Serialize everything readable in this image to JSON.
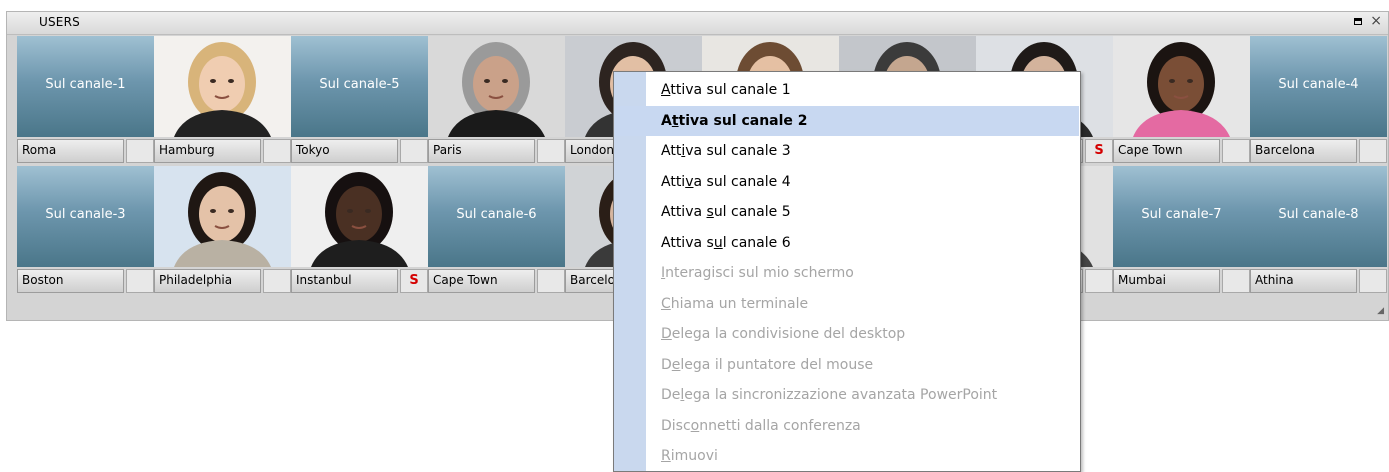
{
  "panel": {
    "title": "USERS",
    "maximize_icon": "maximize-icon",
    "close_icon": "close-icon"
  },
  "row1": [
    {
      "type": "canal",
      "canal_text": "Sul canale-1",
      "label": "Roma",
      "s": ""
    },
    {
      "type": "photo",
      "photo": "woman-blonde",
      "label": "Hamburg",
      "s": ""
    },
    {
      "type": "canal",
      "canal_text": "Sul canale-5",
      "label": "Tokyo",
      "s": ""
    },
    {
      "type": "photo",
      "photo": "man-gray-hair-glasses",
      "label": "Paris",
      "s": ""
    },
    {
      "type": "photo",
      "photo": "woman-dark-hair",
      "label": "London",
      "s": ""
    },
    {
      "type": "photo",
      "photo": "woman-hidden",
      "label": "",
      "s": ""
    },
    {
      "type": "photo",
      "photo": "hidden",
      "label": "",
      "s": ""
    },
    {
      "type": "photo",
      "photo": "woman-dark-hair-2",
      "label": "",
      "s": "S"
    },
    {
      "type": "photo",
      "photo": "woman-smiling",
      "label": "Cape Town",
      "s": ""
    },
    {
      "type": "canal",
      "canal_text": "Sul canale-4",
      "label": "Barcelona",
      "s": ""
    }
  ],
  "row2": [
    {
      "type": "canal",
      "canal_text": "Sul canale-3",
      "label": "Boston",
      "s": ""
    },
    {
      "type": "photo",
      "photo": "woman-asian",
      "label": "Philadelphia",
      "s": ""
    },
    {
      "type": "photo",
      "photo": "man-dark",
      "label": "Instanbul",
      "s": "S"
    },
    {
      "type": "canal",
      "canal_text": "Sul canale-6",
      "label": "Cape Town",
      "s": ""
    },
    {
      "type": "photo",
      "photo": "woman-dark",
      "label": "Barcelona",
      "s": ""
    },
    {
      "type": "photo",
      "photo": "hidden",
      "label": "",
      "s": ""
    },
    {
      "type": "photo",
      "photo": "hidden",
      "label": "",
      "s": ""
    },
    {
      "type": "photo",
      "photo": "woman-hidden-2",
      "label": "",
      "s": ""
    },
    {
      "type": "canal",
      "canal_text": "Sul canale-7",
      "label": "Mumbai",
      "s": ""
    },
    {
      "type": "canal",
      "canal_text": "Sul canale-8",
      "label": "Athina",
      "s": ""
    }
  ],
  "menu": {
    "items": [
      {
        "pre": "",
        "acc": "A",
        "post": "ttiva sul canale 1",
        "state": "enabled"
      },
      {
        "pre": "A",
        "acc": "t",
        "post": "tiva sul canale 2",
        "state": "selected"
      },
      {
        "pre": "Att",
        "acc": "i",
        "post": "va sul canale 3",
        "state": "enabled"
      },
      {
        "pre": "Atti",
        "acc": "v",
        "post": "a sul canale 4",
        "state": "enabled"
      },
      {
        "pre": "Attiva ",
        "acc": "s",
        "post": "ul canale 5",
        "state": "enabled"
      },
      {
        "pre": "Attiva s",
        "acc": "u",
        "post": "l canale 6",
        "state": "enabled"
      },
      {
        "pre": "",
        "acc": "I",
        "post": "nteragisci sul mio schermo",
        "state": "disabled"
      },
      {
        "pre": "",
        "acc": "C",
        "post": "hiama un terminale",
        "state": "disabled"
      },
      {
        "pre": "",
        "acc": "D",
        "post": "elega la condivisione del desktop",
        "state": "disabled"
      },
      {
        "pre": "D",
        "acc": "e",
        "post": "lega il puntatore del mouse",
        "state": "disabled"
      },
      {
        "pre": "De",
        "acc": "l",
        "post": "ega la sincronizzazione avanzata PowerPoint",
        "state": "disabled"
      },
      {
        "pre": "Disc",
        "acc": "o",
        "post": "nnetti dalla conferenza",
        "state": "disabled"
      },
      {
        "pre": "",
        "acc": "R",
        "post": "imuovi",
        "state": "disabled"
      }
    ]
  },
  "colors": {
    "menu_gutter": "#c9d8ee",
    "menu_selected": "#c8d8f1",
    "s_badge": "#d40000",
    "disabled_text": "#a5a5a5"
  }
}
